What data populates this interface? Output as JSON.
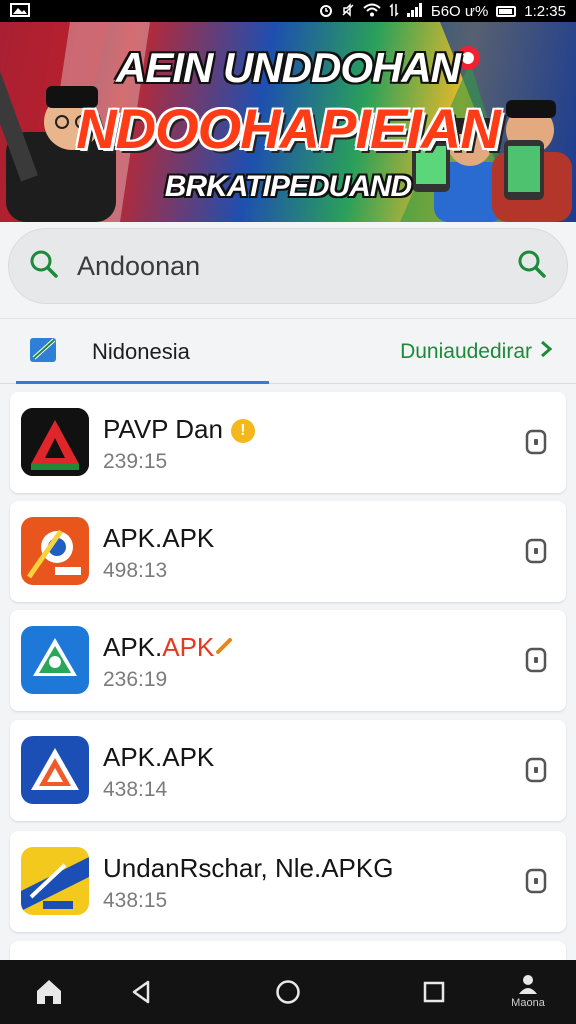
{
  "status_bar": {
    "left_icon": "picture-notification-icon",
    "battery_text": "Б6О ư%",
    "time": "1:2:35"
  },
  "banner": {
    "line1": "AEIN UNDDOHAN",
    "line2": "NDOOHAPIEIAN",
    "line3": "BRKATIPEDUAND",
    "colors": {
      "red": "#ff3c16",
      "blue": "#1e4fb0",
      "green": "#2aa05a"
    }
  },
  "search": {
    "query": "Andoonan",
    "icon_left": "search-icon",
    "icon_right": "search-icon"
  },
  "tabs": {
    "active_label": "Nidonesia",
    "active_icon": "flag-tile-icon",
    "right_link": "Duniaudedirar",
    "right_icon": "chevron-right-icon",
    "underline_color": "#2f7fd6",
    "link_color": "#1d8a3a"
  },
  "apps": [
    {
      "name": "PAVP Dan",
      "meta": "239:15",
      "icon": "red-triangle-app-icon",
      "badge": "!"
    },
    {
      "name": "APK.APK",
      "meta": "498:13",
      "icon": "orange-sunrise-app-icon"
    },
    {
      "name_a": "APK.",
      "name_b": "APK",
      "meta": "236:19",
      "icon": "green-recycle-app-icon",
      "suffix_icon": "pencil-icon"
    },
    {
      "name": "APK.APK",
      "meta": "438:14",
      "icon": "blue-orange-triangle-app-icon"
    },
    {
      "name": "UndanRschar, Nle.APKG",
      "meta": "438:15",
      "icon": "yellow-blue-stripe-app-icon"
    }
  ],
  "nav": {
    "items": [
      "home-icon",
      "back-icon",
      "home-circle-icon",
      "recents-icon",
      "profile-icon"
    ],
    "profile_label": "Maona"
  }
}
